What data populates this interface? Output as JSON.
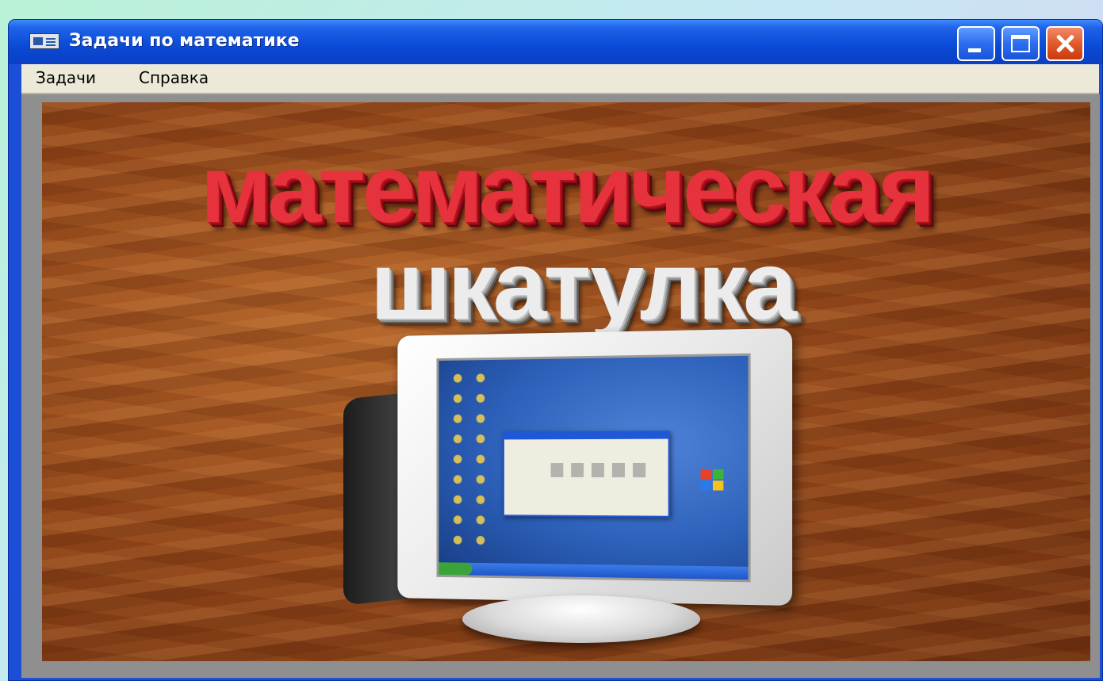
{
  "window": {
    "title": "Задачи по математике",
    "icon": "app-window-icon",
    "controls": {
      "minimize": "minimize-icon",
      "maximize": "maximize-icon",
      "close": "close-icon"
    }
  },
  "menu": {
    "items": [
      {
        "label": "Задачи"
      },
      {
        "label": "Справка"
      }
    ]
  },
  "splash": {
    "line1": "математическая",
    "line2": "шкатулка"
  },
  "colors": {
    "titlebar": "#0b4ad6",
    "close_button": "#e25a2a",
    "menubar": "#ece9d8",
    "title_red": "#e5323c",
    "title_silver": "#ececec",
    "wood": "#93481a"
  }
}
